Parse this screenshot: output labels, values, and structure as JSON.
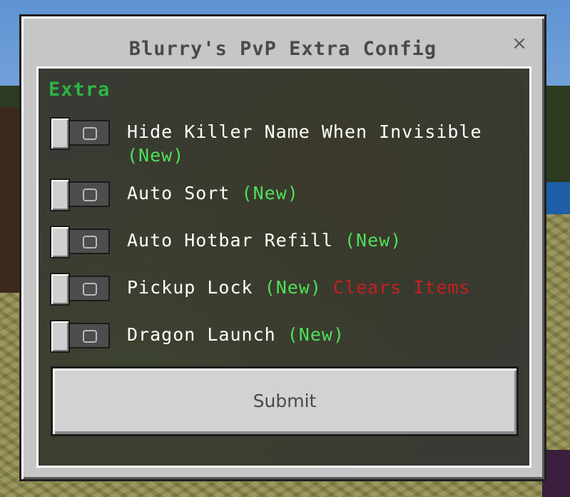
{
  "dialog": {
    "title": "Blurry's PvP Extra Config",
    "close_icon": "×"
  },
  "section": {
    "header": "Extra"
  },
  "options": [
    {
      "label": "Hide Killer Name When Invisible",
      "tag": "(New)",
      "warning": "",
      "enabled": false
    },
    {
      "label": "Auto Sort",
      "tag": "(New)",
      "warning": "",
      "enabled": false
    },
    {
      "label": "Auto Hotbar Refill",
      "tag": "(New)",
      "warning": "",
      "enabled": false
    },
    {
      "label": "Pickup Lock",
      "tag": "(New)",
      "warning": "Clears Items",
      "enabled": false
    },
    {
      "label": "Dragon Launch",
      "tag": "(New)",
      "warning": "",
      "enabled": false
    }
  ],
  "submit": {
    "label": "Submit"
  },
  "colors": {
    "section_header": "#2fb346",
    "new_tag": "#4fe05a",
    "warning": "#c62020",
    "panel": "#c6c6c6"
  },
  "icons": {
    "toggle_off_mark": "circle-off-icon",
    "close": "close-icon"
  }
}
